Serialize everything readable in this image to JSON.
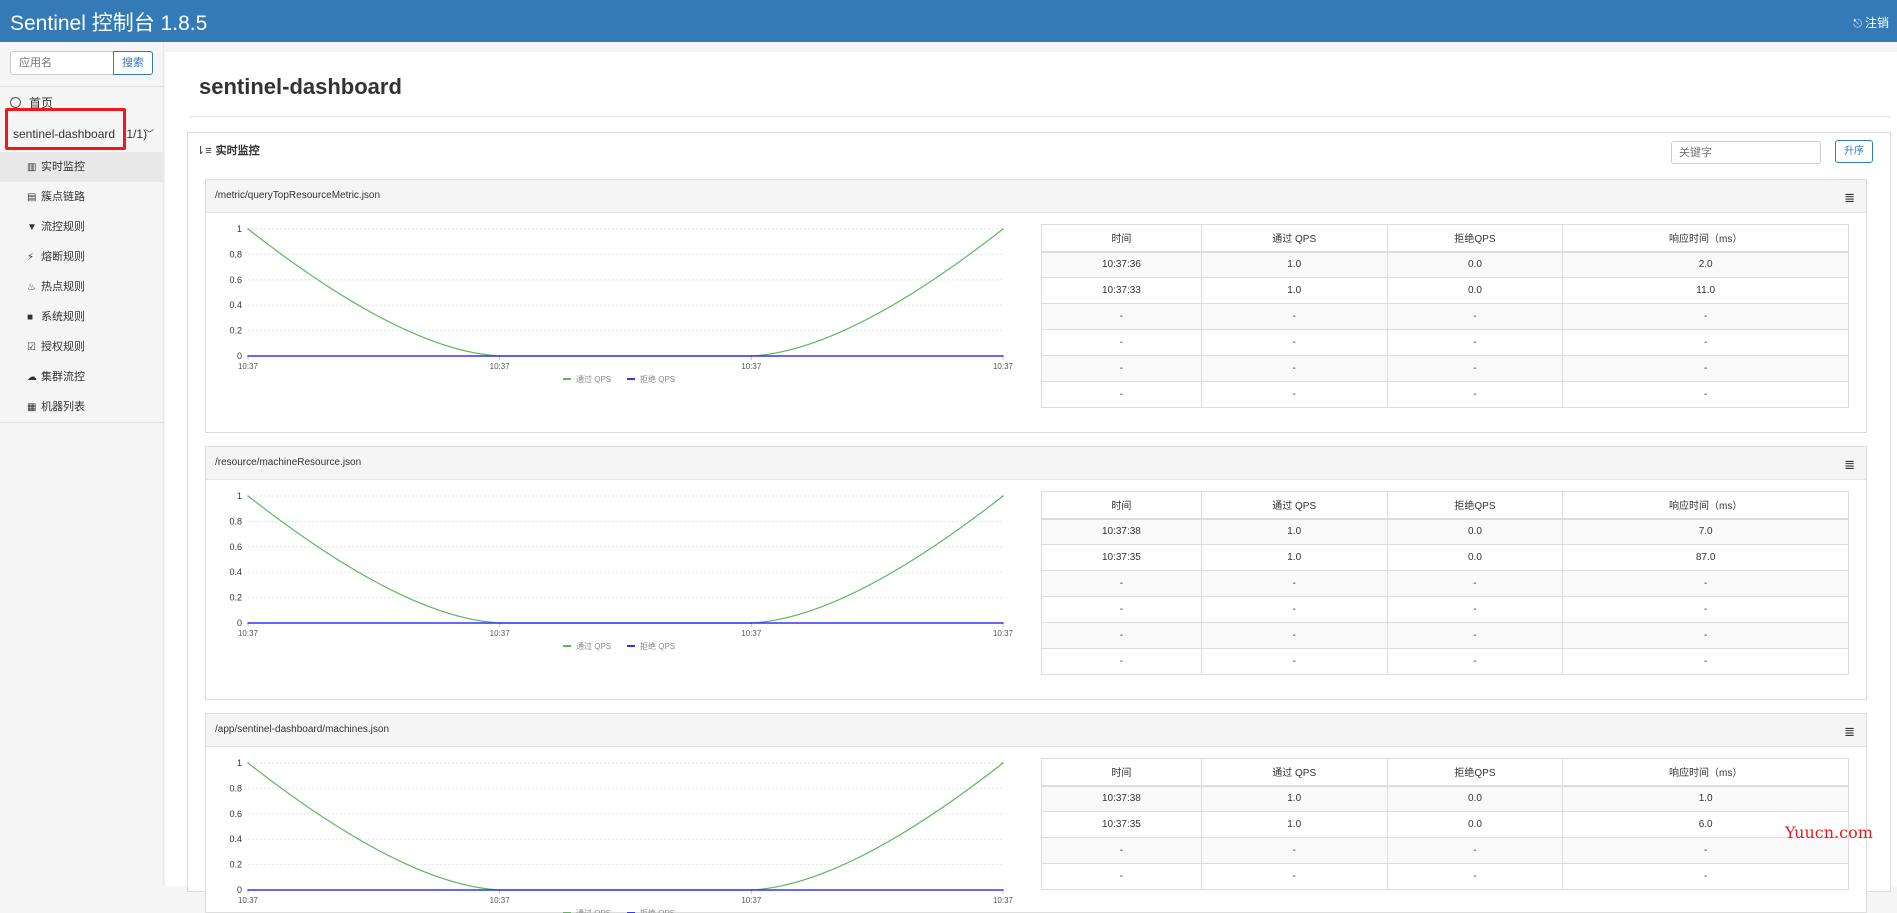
{
  "header": {
    "brand": "Sentinel 控制台 1.8.5",
    "logout": "注销"
  },
  "sidebar": {
    "search": {
      "placeholder": "应用名",
      "button": "搜索"
    },
    "home": "首页",
    "app": {
      "label": "sentinel-dashboard",
      "count": "(1/1)"
    },
    "menu": [
      {
        "label": "实时监控",
        "icon": "bar-chart-icon",
        "glyph": "▥"
      },
      {
        "label": "簇点链路",
        "icon": "list-icon",
        "glyph": "▤"
      },
      {
        "label": "流控规则",
        "icon": "filter-icon",
        "glyph": "▼"
      },
      {
        "label": "熔断规则",
        "icon": "bolt-icon",
        "glyph": "⚡"
      },
      {
        "label": "热点规则",
        "icon": "fire-icon",
        "glyph": "♨"
      },
      {
        "label": "系统规则",
        "icon": "lock-icon",
        "glyph": "■"
      },
      {
        "label": "授权规则",
        "icon": "check-icon",
        "glyph": "☑"
      },
      {
        "label": "集群流控",
        "icon": "cloud-icon",
        "glyph": "☁"
      },
      {
        "label": "机器列表",
        "icon": "grid-icon",
        "glyph": "▦"
      }
    ]
  },
  "main": {
    "title": "sentinel-dashboard",
    "panel": {
      "title": "实时监控",
      "keyword_placeholder": "关键字",
      "sort_button": "升序"
    },
    "table_headers": [
      "时间",
      "通过 QPS",
      "拒绝QPS",
      "响应时间（ms）"
    ],
    "legend": [
      "通过 QPS",
      "拒绝 QPS"
    ],
    "colors": {
      "pass": "#5cb85c",
      "block": "#3333ff",
      "brand": "#337ab7"
    }
  },
  "resources": [
    {
      "name": "/metric/queryTopResourceMetric.json",
      "rows": [
        [
          "10:37:36",
          "1.0",
          "0.0",
          "2.0"
        ],
        [
          "10:37:33",
          "1.0",
          "0.0",
          "11.0"
        ],
        [
          "-",
          "-",
          "-",
          "-"
        ],
        [
          "-",
          "-",
          "-",
          "-"
        ],
        [
          "-",
          "-",
          "-",
          "-"
        ],
        [
          "-",
          "-",
          "-",
          "-"
        ]
      ],
      "chart_data": {
        "type": "line",
        "x": [
          "10:37",
          "10:37",
          "10:37",
          "10:37"
        ],
        "yticks": [
          "1",
          "0.8",
          "0.6",
          "0.4",
          "0.2",
          "0"
        ],
        "ylim": [
          0,
          1
        ],
        "series": [
          {
            "name": "通过 QPS",
            "values": [
              1,
              0,
              0,
              1
            ]
          },
          {
            "name": "拒绝 QPS",
            "values": [
              0,
              0,
              0,
              0
            ]
          }
        ]
      }
    },
    {
      "name": "/resource/machineResource.json",
      "rows": [
        [
          "10:37:38",
          "1.0",
          "0.0",
          "7.0"
        ],
        [
          "10:37:35",
          "1.0",
          "0.0",
          "87.0"
        ],
        [
          "-",
          "-",
          "-",
          "-"
        ],
        [
          "-",
          "-",
          "-",
          "-"
        ],
        [
          "-",
          "-",
          "-",
          "-"
        ],
        [
          "-",
          "-",
          "-",
          "-"
        ]
      ],
      "chart_data": {
        "type": "line",
        "x": [
          "10:37",
          "10:37",
          "10:37",
          "10:37"
        ],
        "yticks": [
          "1",
          "0.8",
          "0.6",
          "0.4",
          "0.2",
          "0"
        ],
        "ylim": [
          0,
          1
        ],
        "series": [
          {
            "name": "通过 QPS",
            "values": [
              1,
              0,
              0,
              1
            ]
          },
          {
            "name": "拒绝 QPS",
            "values": [
              0,
              0,
              0,
              0
            ]
          }
        ]
      }
    },
    {
      "name": "/app/sentinel-dashboard/machines.json",
      "rows": [
        [
          "10:37:38",
          "1.0",
          "0.0",
          "1.0"
        ],
        [
          "10:37:35",
          "1.0",
          "0.0",
          "6.0"
        ],
        [
          "-",
          "-",
          "-",
          "-"
        ],
        [
          "-",
          "-",
          "-",
          "-"
        ]
      ],
      "chart_data": {
        "type": "line",
        "x": [
          "10:37",
          "10:37",
          "10:37",
          "10:37"
        ],
        "yticks": [
          "1",
          "0.8",
          "0.6",
          "0.4",
          "0.2",
          "0"
        ],
        "ylim": [
          0,
          1
        ],
        "series": [
          {
            "name": "通过 QPS",
            "values": [
              1,
              0,
              0,
              1
            ]
          },
          {
            "name": "拒绝 QPS",
            "values": [
              0,
              0,
              0,
              0
            ]
          }
        ]
      }
    }
  ],
  "watermark": "Yuucn.com"
}
